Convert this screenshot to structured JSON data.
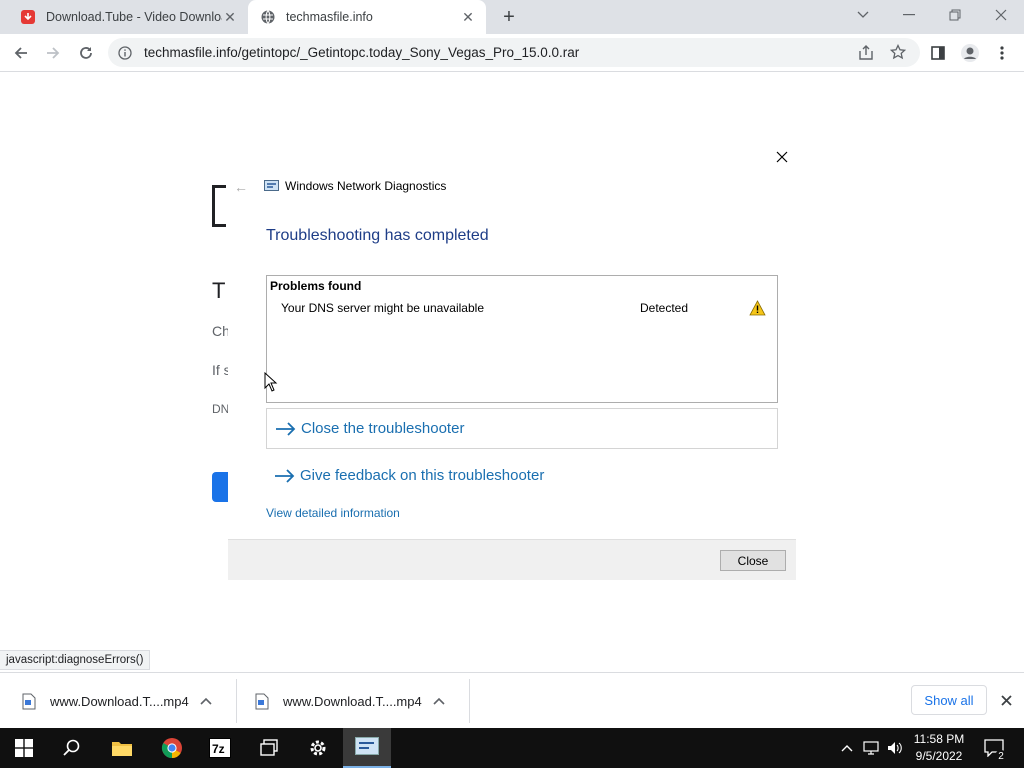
{
  "tabs": [
    {
      "title": "Download.Tube - Video Downloa",
      "favicon": "download-tube-favicon",
      "active": false
    },
    {
      "title": "techmasfile.info",
      "favicon": "globe-icon",
      "active": true
    }
  ],
  "toolbar": {
    "url": "techmasfile.info/getintopc/_Getintopc.today_Sony_Vegas_Pro_15.0.0.rar"
  },
  "background_page": {
    "heading_fragment": "T",
    "line1_fragment": "Ch",
    "line2_fragment": "If s",
    "line3_fragment": "DN"
  },
  "dialog": {
    "window_title": "Windows Network Diagnostics",
    "heading": "Troubleshooting has completed",
    "problems_header": "Problems found",
    "problem": {
      "name": "Your DNS server might be unavailable",
      "status": "Detected",
      "icon": "warning-icon"
    },
    "close_troubleshooter": "Close the troubleshooter",
    "give_feedback": "Give feedback on this troubleshooter",
    "view_details": "View detailed information",
    "close_button": "Close"
  },
  "status_bar": {
    "text": "javascript:diagnoseErrors()"
  },
  "downloads": {
    "items": [
      {
        "name": "www.Download.T....mp4"
      },
      {
        "name": "www.Download.T....mp4"
      }
    ],
    "show_all": "Show all"
  },
  "taskbar": {
    "apps": [
      "windows-start-icon",
      "search-icon",
      "file-explorer-icon",
      "chrome-icon",
      "7zip-icon",
      "task-view-icon",
      "settings-icon",
      "network-diagnostics-icon"
    ],
    "time": "11:58 PM",
    "date": "9/5/2022",
    "notification_count": "2"
  },
  "colors": {
    "accent": "#1a73e8",
    "dialog_heading": "#1e3d87",
    "link": "#1a6fb0",
    "taskbar": "#101010"
  }
}
